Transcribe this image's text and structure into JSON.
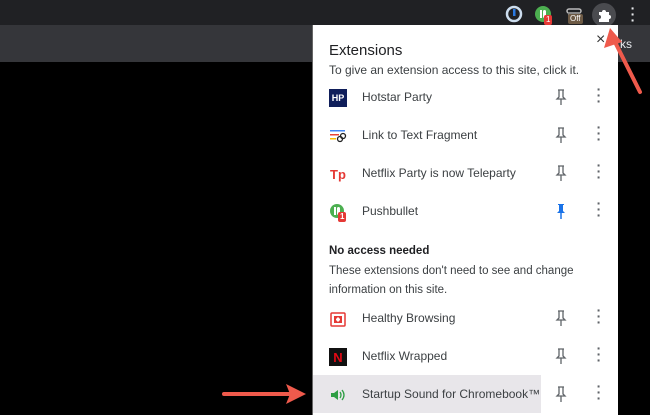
{
  "toolbar": {
    "pushbullet_badge": "1",
    "off_badge": "Off",
    "bookmarks_partial": "rks"
  },
  "popup": {
    "title": "Extensions",
    "subtitle": "To give an extension access to this site, click it.",
    "close": "×",
    "access_items": [
      {
        "name": "Hotstar Party",
        "icon": "HP",
        "pinned": false
      },
      {
        "name": "Link to Text Fragment",
        "pinned": false
      },
      {
        "name": "Netflix Party is now Teleparty",
        "icon": "Tp",
        "pinned": false
      },
      {
        "name": "Pushbullet",
        "badge": "1",
        "pinned": true
      }
    ],
    "section_title": "No access needed",
    "section_desc": "These extensions don't need to see and change information on this site.",
    "no_access_items": [
      {
        "name": "Healthy Browsing",
        "pinned": false
      },
      {
        "name": "Netflix Wrapped",
        "icon": "N",
        "pinned": false
      },
      {
        "name": "Startup Sound for Chromebook™",
        "pinned": false,
        "highlighted": true
      }
    ],
    "more_glyph": "⋮"
  },
  "colors": {
    "accent_pin": "#1a73e8",
    "arrow": "#ef5a4c"
  }
}
